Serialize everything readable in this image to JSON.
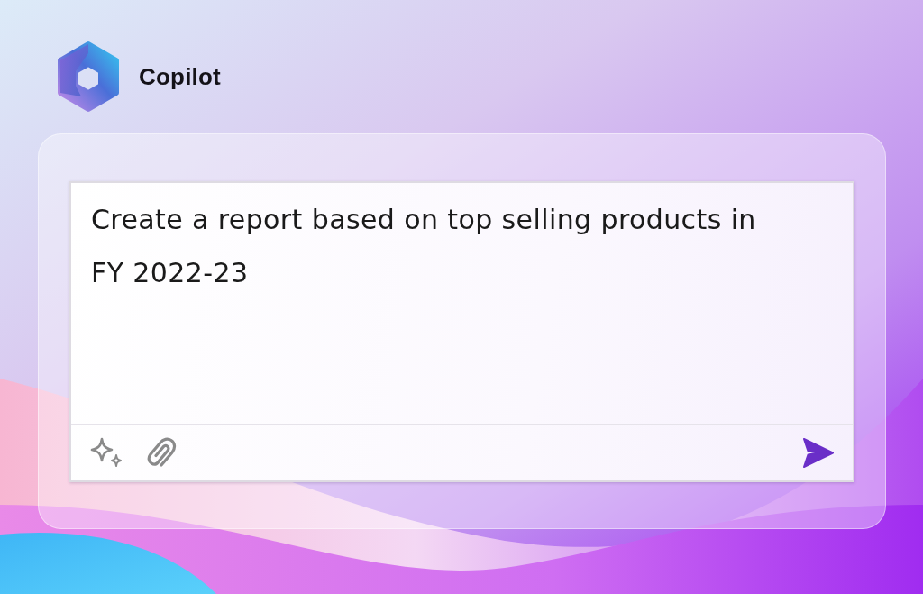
{
  "app": {
    "name": "Copilot"
  },
  "prompt": {
    "value": "Create a report based on top selling products in FY 2022-23"
  }
}
